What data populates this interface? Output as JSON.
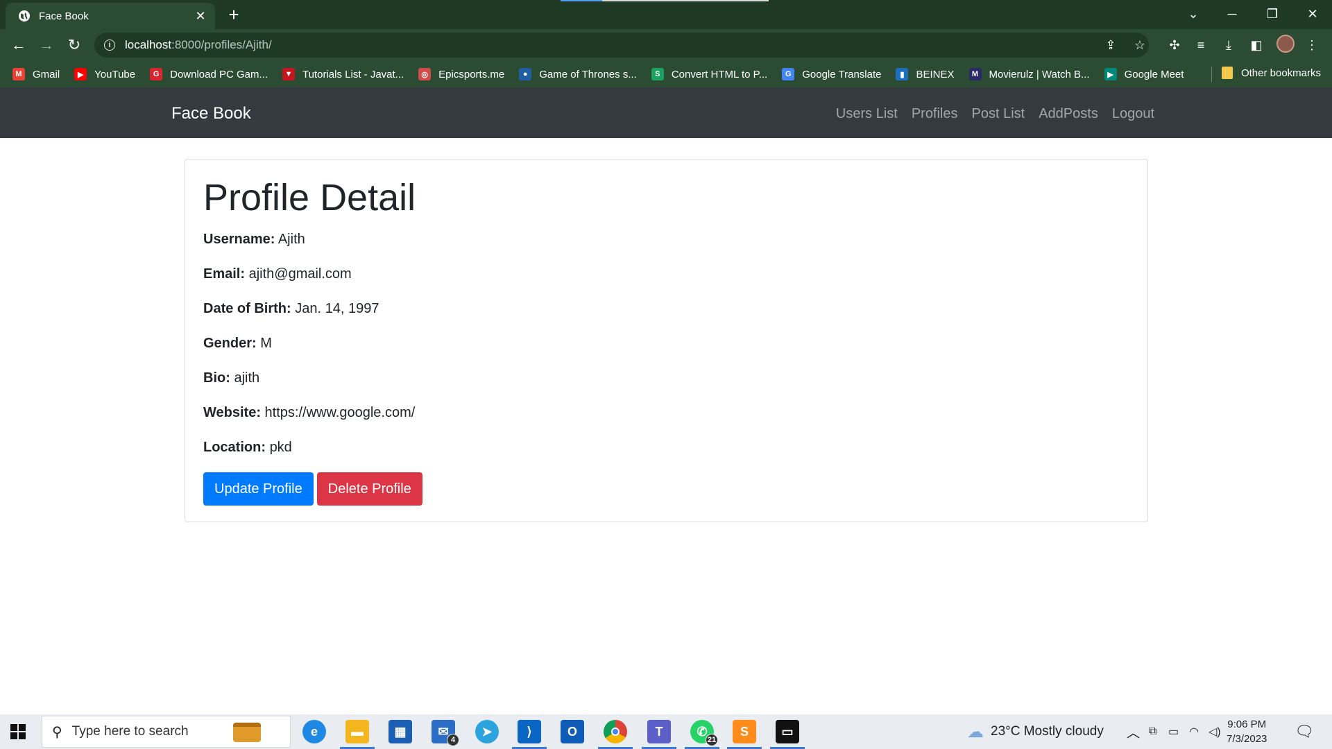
{
  "browser": {
    "tab_title": "Face Book",
    "url_host": "localhost",
    "url_path": ":8000/profiles/Ajith/",
    "bookmarks": [
      {
        "label": "Gmail",
        "color": "#ea4335",
        "glyph": "M"
      },
      {
        "label": "YouTube",
        "color": "#ff0000",
        "glyph": "▶"
      },
      {
        "label": "Download PC Gam...",
        "color": "#d7262f",
        "glyph": "G"
      },
      {
        "label": "Tutorials List - Javat...",
        "color": "#c5161d",
        "glyph": "▼"
      },
      {
        "label": "Epicsports.me",
        "color": "#d14b4b",
        "glyph": "◎"
      },
      {
        "label": "Game of Thrones s...",
        "color": "#1f5f9f",
        "glyph": "●"
      },
      {
        "label": "Convert HTML to P...",
        "color": "#1aa260",
        "glyph": "S"
      },
      {
        "label": "Google Translate",
        "color": "#4285f4",
        "glyph": "G"
      },
      {
        "label": "BEINEX",
        "color": "#1c6fbf",
        "glyph": "▮"
      },
      {
        "label": "Movierulz | Watch B...",
        "color": "#2a2a6a",
        "glyph": "M"
      },
      {
        "label": "Google Meet",
        "color": "#00897b",
        "glyph": "▶"
      }
    ],
    "other_bookmarks": "Other bookmarks"
  },
  "app": {
    "brand": "Face Book",
    "nav": [
      "Users List",
      "Profiles",
      "Post List",
      "AddPosts",
      "Logout"
    ]
  },
  "profile": {
    "heading": "Profile Detail",
    "fields": [
      {
        "label": "Username:",
        "value": "Ajith"
      },
      {
        "label": "Email:",
        "value": "ajith@gmail.com"
      },
      {
        "label": "Date of Birth:",
        "value": "Jan. 14, 1997"
      },
      {
        "label": "Gender:",
        "value": "M"
      },
      {
        "label": "Bio:",
        "value": "ajith"
      },
      {
        "label": "Website:",
        "value": "https://www.google.com/"
      },
      {
        "label": "Location:",
        "value": "pkd"
      }
    ],
    "update_label": "Update Profile",
    "delete_label": "Delete Profile"
  },
  "taskbar": {
    "search_placeholder": "Type here to search",
    "mail_badge": "4",
    "whatsapp_badge": "21",
    "weather": "23°C  Mostly cloudy",
    "time": "9:06 PM",
    "date": "7/3/2023"
  }
}
